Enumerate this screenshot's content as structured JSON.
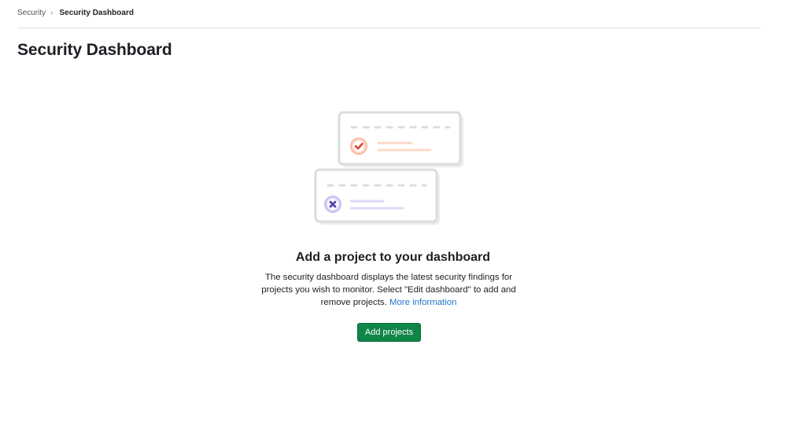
{
  "breadcrumb": {
    "parent": "Security",
    "current": "Security Dashboard"
  },
  "page": {
    "title": "Security Dashboard"
  },
  "empty_state": {
    "title": "Add a project to your dashboard",
    "description": "The security dashboard displays the latest security findings for projects you wish to monitor. Select \"Edit dashboard\" to add and remove projects.",
    "link_label": "More information",
    "button_label": "Add projects",
    "illustration": {
      "top_card_icon": "check-icon",
      "bottom_card_icon": "x-icon"
    }
  },
  "colors": {
    "primary_button": "#108548",
    "link": "#1f75cb",
    "success_accent": "#e24329",
    "error_accent": "#5943b6"
  }
}
